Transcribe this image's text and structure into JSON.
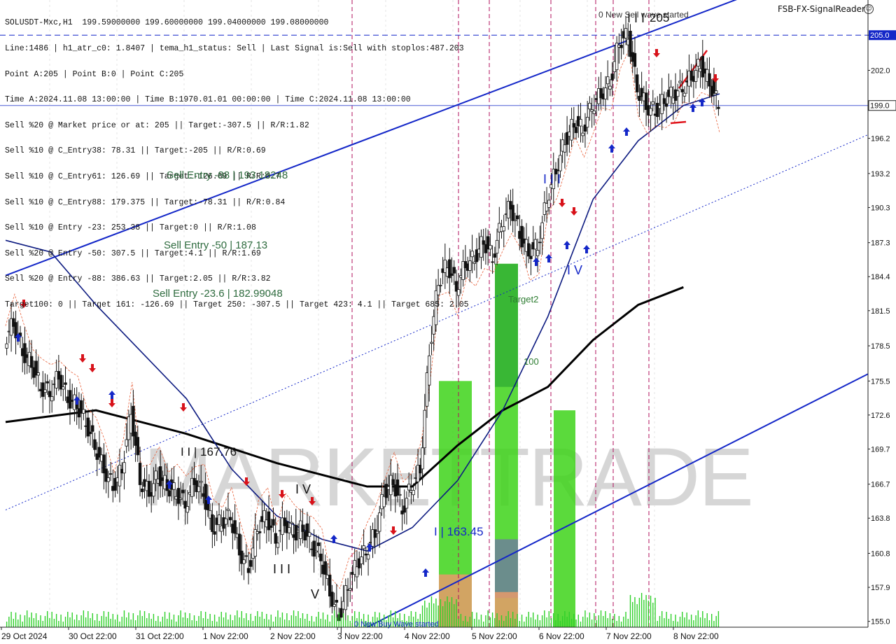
{
  "info_lines": [
    "SOLUSDT-Mxc,H1  199.59000000 199.60000000 199.04000000 199.08000000",
    "Line:1486 | h1_atr_c0: 1.8407 | tema_h1_status: Sell | Last Signal is:Sell with stoplos:487.203",
    "Point A:205 | Point B:0 | Point C:205",
    "Time A:2024.11.08 13:00:00 | Time B:1970.01.01 00:00:00 | Time C:2024.11.08 13:00:00",
    "Sell %20 @ Market price or at: 205 || Target:-307.5 || R/R:1.82",
    "Sell %10 @ C_Entry38: 78.31 || Target:-205 || R/R:0.69",
    "Sell %10 @ C_Entry61: 126.69 || Target:-126.69 || R/R:0.7",
    "Sell %10 @ C_Entry88: 179.375 || Target:-78.31 || R/R:0.84",
    "Sell %10 @ Entry -23: 253.38 || Target:0 || R/R:1.08",
    "Sell %20 @ Entry -50: 307.5 || Target:4.1 || R/R:1.69",
    "Sell %20 @ Entry -88: 386.63 || Target:2.05 || R/R:3.82",
    "Target100: 0 || Target 161: -126.69 || Target 250: -307.5 || Target 423: 4.1 || Target 685: 2.05"
  ],
  "brand": "FSB-FX-SignalReader",
  "brand_icon": "smiley-icon",
  "watermark": "MARKETTRADE",
  "levels": [
    {
      "text": "Sell Entry -88 | 193.18248",
      "price": 193.18
    },
    {
      "text": "Sell Entry -50 | 187.13",
      "price": 187.13
    },
    {
      "text": "Sell Entry -23.6 | 182.99048",
      "price": 182.99
    }
  ],
  "annotations": {
    "high_label": "0 New Sell wave started",
    "point_205": "205",
    "wave_i_low": "I | 163.45",
    "wave_ii": "I I | 167.76",
    "low_label": "0 New Buy Wave started",
    "target2": "Target2",
    "t100": "100",
    "wave_iii_a": "I I I",
    "wave_iv_a": "I V",
    "wave_v_a": "V",
    "wave_iii_b": "I I I",
    "wave_iv_b": "I V",
    "wave_iii_c": "I I I"
  },
  "colors": {
    "bull": "#1f9e3a",
    "bear": "#d8121a",
    "channel": "#1427c8",
    "ma200": "#000000",
    "ma_fast": "#0c1a80",
    "target_green": "#3ed31a"
  },
  "chart_data": {
    "type": "candlestick",
    "symbol": "SOLUSDT-Mxc",
    "timeframe": "H1",
    "ohlc_last": {
      "open": 199.59,
      "high": 199.6,
      "low": 199.04,
      "close": 199.08
    },
    "price_ticks": [
      205.0,
      202.0,
      199.0,
      196.2,
      193.2,
      190.3,
      187.3,
      184.4,
      181.5,
      178.5,
      175.5,
      172.6,
      169.7,
      166.7,
      163.8,
      160.8,
      157.9,
      155.0
    ],
    "current_price": "199.08",
    "marked_levels": [
      "205.0",
      "199.0"
    ],
    "ylim": [
      154.5,
      208
    ],
    "x_ticks": [
      "29 Oct 2024",
      "30 Oct 22:00",
      "31 Oct 22:00",
      "1 Nov 22:00",
      "2 Nov 22:00",
      "3 Nov 22:00",
      "4 Nov 22:00",
      "5 Nov 22:00",
      "6 Nov 22:00",
      "7 Nov 22:00",
      "8 Nov 22:00"
    ],
    "price_path": [
      [
        0,
        179
      ],
      [
        1,
        180.5
      ],
      [
        2,
        178
      ],
      [
        3,
        177
      ],
      [
        4,
        175
      ],
      [
        5,
        174.5
      ],
      [
        6,
        176
      ],
      [
        7,
        174
      ],
      [
        8,
        173.5
      ],
      [
        9,
        172
      ],
      [
        10,
        170
      ],
      [
        11,
        168
      ],
      [
        12,
        166.5
      ],
      [
        13,
        168
      ],
      [
        14,
        173
      ],
      [
        15,
        167
      ],
      [
        16,
        166
      ],
      [
        17,
        167.5
      ],
      [
        18,
        166.5
      ],
      [
        19,
        166
      ],
      [
        20,
        165
      ],
      [
        21,
        167
      ],
      [
        22,
        166
      ],
      [
        23,
        163
      ],
      [
        24,
        163.5
      ],
      [
        25,
        164
      ],
      [
        26,
        161
      ],
      [
        27,
        159.5
      ],
      [
        28,
        163
      ],
      [
        29,
        164
      ],
      [
        30,
        162
      ],
      [
        31,
        163.5
      ],
      [
        32,
        162.5
      ],
      [
        33,
        163
      ],
      [
        34,
        161.5
      ],
      [
        35,
        160.5
      ],
      [
        36,
        157.5
      ],
      [
        37,
        155.4
      ],
      [
        38,
        158
      ],
      [
        39,
        160
      ],
      [
        40,
        161
      ],
      [
        41,
        162.5
      ],
      [
        42,
        166
      ],
      [
        43,
        167
      ],
      [
        44,
        164.5
      ],
      [
        45,
        166.5
      ],
      [
        46,
        168
      ],
      [
        47,
        178
      ],
      [
        48,
        184
      ],
      [
        49,
        185.5
      ],
      [
        50,
        183.5
      ],
      [
        51,
        185.5
      ],
      [
        52,
        186
      ],
      [
        53,
        187.5
      ],
      [
        54,
        186
      ],
      [
        55,
        189
      ],
      [
        56,
        190.5
      ],
      [
        57,
        188
      ],
      [
        58,
        186.5
      ],
      [
        59,
        187
      ],
      [
        60,
        191
      ],
      [
        61,
        193.5
      ],
      [
        62,
        196
      ],
      [
        63,
        197.5
      ],
      [
        64,
        197
      ],
      [
        65,
        199
      ],
      [
        66,
        200
      ],
      [
        67,
        201
      ],
      [
        68,
        204.5
      ],
      [
        69,
        205
      ],
      [
        70,
        200.5
      ],
      [
        71,
        199
      ],
      [
        72,
        198.5
      ],
      [
        73,
        199.5
      ],
      [
        74,
        200
      ],
      [
        75,
        200.5
      ],
      [
        76,
        201.5
      ],
      [
        77,
        202.5
      ],
      [
        78,
        201
      ],
      [
        79,
        199.08
      ]
    ],
    "ma200": [
      [
        0,
        172
      ],
      [
        10,
        173
      ],
      [
        20,
        171
      ],
      [
        30,
        168.5
      ],
      [
        40,
        166.5
      ],
      [
        45,
        166.5
      ],
      [
        50,
        170
      ],
      [
        55,
        173
      ],
      [
        60,
        175
      ],
      [
        65,
        179
      ],
      [
        70,
        182
      ],
      [
        75,
        183.5
      ]
    ],
    "ma_fast": [
      [
        0,
        187.5
      ],
      [
        5,
        186.5
      ],
      [
        10,
        182
      ],
      [
        15,
        178
      ],
      [
        20,
        174
      ],
      [
        25,
        168
      ],
      [
        30,
        164
      ],
      [
        35,
        162
      ],
      [
        40,
        161
      ],
      [
        45,
        163
      ],
      [
        50,
        167
      ],
      [
        55,
        173
      ],
      [
        60,
        181
      ],
      [
        65,
        191
      ],
      [
        70,
        196
      ],
      [
        75,
        199
      ],
      [
        79,
        200
      ]
    ],
    "channel_upper": [
      [
        0,
        184.5
      ],
      [
        79,
        207.5
      ]
    ],
    "channel_mid_dotted": [
      [
        0,
        164.5
      ],
      [
        79,
        191
      ]
    ],
    "channel_lower": [
      [
        40,
        154.5
      ],
      [
        79,
        169.7
      ]
    ]
  }
}
